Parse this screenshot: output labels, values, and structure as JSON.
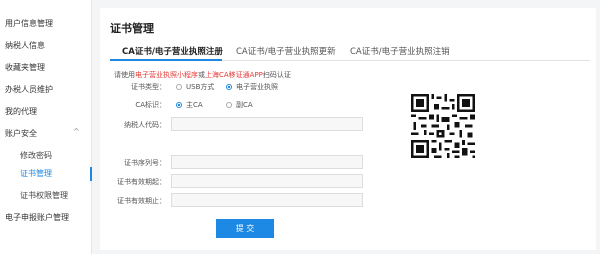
{
  "sidebar": {
    "items": [
      {
        "label": "用户信息管理"
      },
      {
        "label": "纳税人信息"
      },
      {
        "label": "收藏夹管理"
      },
      {
        "label": "办税人员维护"
      },
      {
        "label": "我的代理"
      },
      {
        "label": "账户安全",
        "arrow": "^"
      },
      {
        "label": "修改密码"
      },
      {
        "label": "证书管理"
      },
      {
        "label": "证书权限管理"
      },
      {
        "label": "电子申报账户管理"
      }
    ]
  },
  "page": {
    "title": "证书管理",
    "tabs": [
      {
        "label": "CA证书/电子营业执照注册"
      },
      {
        "label": "CA证书/电子营业执照更新"
      },
      {
        "label": "CA证书/电子营业执照注销"
      }
    ],
    "notice": {
      "pre": "请使用",
      "link1": "电子营业执照小程序",
      "mid": "或",
      "link2": "上海CA移证通APP",
      "post": "扫码认证"
    },
    "form": {
      "cert_type_label": "证书类型：",
      "cert_type_options": [
        "USB方式",
        "电子营业执照"
      ],
      "ca_mark_label": "CA标识：",
      "ca_mark_options": [
        "主CA",
        "副CA"
      ],
      "taxpayer_code_label": "纳税人代码：",
      "taxpayer_code_value": "",
      "cert_serial_label": "证书序列号：",
      "cert_serial_value": "",
      "valid_from_label": "证书有效期起：",
      "valid_from_value": "",
      "valid_to_label": "证书有效期止：",
      "valid_to_value": "",
      "submit_label": "提 交"
    },
    "colors": {
      "accent": "#1e88e5",
      "warning": "#e53935"
    }
  }
}
